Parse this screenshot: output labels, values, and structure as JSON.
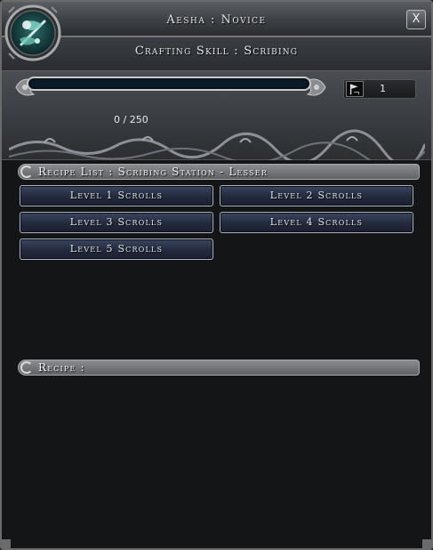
{
  "window": {
    "title": "Aesha : Novice",
    "close_label": "X"
  },
  "skill": {
    "header": "Crafting Skill : Scribing",
    "progress_text": "0 / 250",
    "progress_fraction": 0,
    "level_value": "1"
  },
  "recipe_list": {
    "header": "Recipe List : Scribing Station - Lesser",
    "buttons": [
      "Level 1 Scrolls",
      "Level 2 Scrolls",
      "Level 3 Scrolls",
      "Level 4 Scrolls",
      "Level 5 Scrolls"
    ]
  },
  "recipe": {
    "header": "Recipe :"
  },
  "icons": {
    "emblem": "scribing-emblem-icon",
    "level": "flag-icon",
    "close": "close-icon"
  },
  "colors": {
    "bar_fill": "#4e8fd0",
    "button_bg": "#232a3d",
    "panel_bg": "#141517"
  }
}
